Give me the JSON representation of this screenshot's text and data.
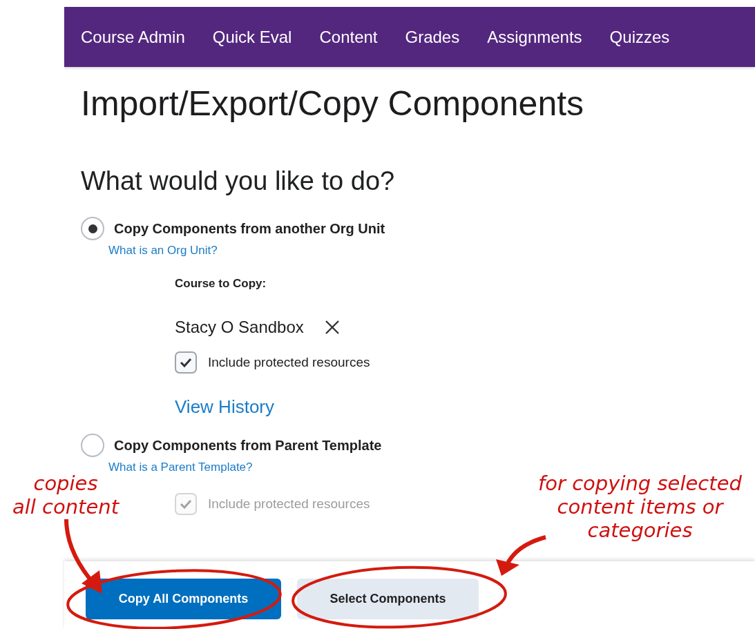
{
  "nav": {
    "items": [
      "Course Admin",
      "Quick Eval",
      "Content",
      "Grades",
      "Assignments",
      "Quizzes"
    ]
  },
  "page_title": "Import/Export/Copy Components",
  "question": "What would you like to do?",
  "options": [
    {
      "label": "Copy Components from another Org Unit",
      "selected": true,
      "obscured": false,
      "help_link": "What is an Org Unit?",
      "course_label": "Course to Copy:",
      "course": "Stacy O Sandbox",
      "include": {
        "label": "Include protected resources",
        "checked": true,
        "disabled": false
      },
      "history_link": "View History"
    },
    {
      "label": "Copy Components from Parent Template",
      "selected": false,
      "obscured": false,
      "help_link": "What is a Parent Template?",
      "include": {
        "label": "Include protected resources",
        "checked": true,
        "disabled": true
      }
    }
  ],
  "buttons": [
    {
      "label": "Copy All Components",
      "kind": "primary"
    },
    {
      "label": "Select Components",
      "kind": "secondary"
    }
  ],
  "annotations": [
    {
      "text": "copies\nall content"
    },
    {
      "text": "for copying selected\ncontent items or\ncategories"
    }
  ]
}
